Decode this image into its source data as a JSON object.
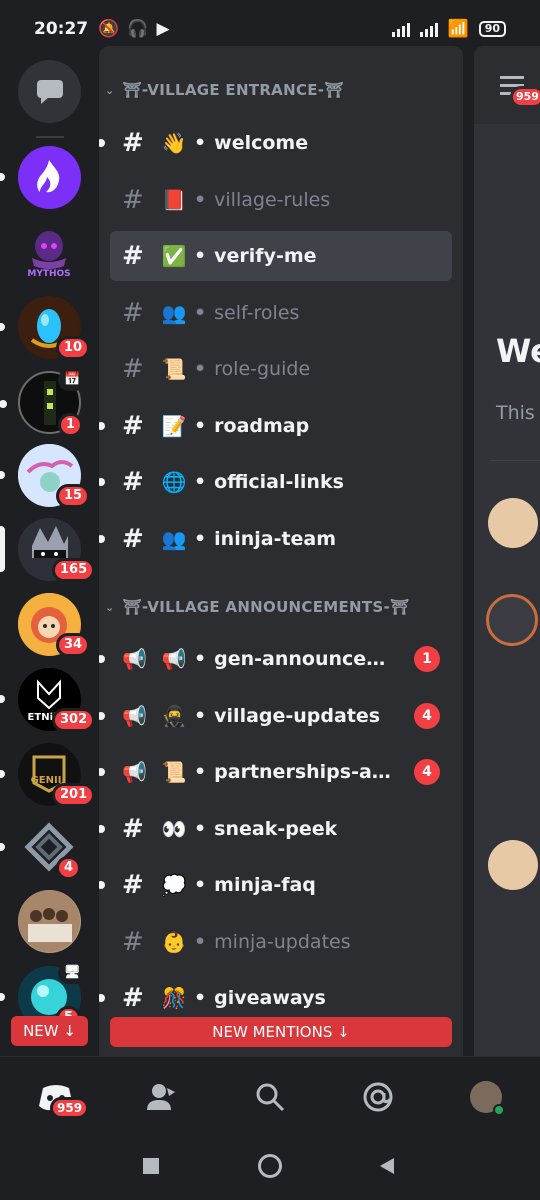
{
  "status_bar": {
    "time": "20:27",
    "battery": "90"
  },
  "servers": [
    {
      "name": "server-1-flame",
      "badge": ""
    },
    {
      "name": "server-2-mythos",
      "label": "MYTHOS",
      "badge": ""
    },
    {
      "name": "server-3-egg",
      "badge": "10"
    },
    {
      "name": "server-4",
      "badge": "1"
    },
    {
      "name": "server-5",
      "badge": "15"
    },
    {
      "name": "server-6",
      "badge": "165"
    },
    {
      "name": "server-7",
      "badge": "34"
    },
    {
      "name": "server-8",
      "label": "ETNii",
      "badge": "302"
    },
    {
      "name": "server-9",
      "label": "GENII",
      "badge": "201"
    },
    {
      "name": "server-10",
      "badge": "4"
    },
    {
      "name": "server-11",
      "badge": ""
    },
    {
      "name": "server-12",
      "badge": "5"
    }
  ],
  "categories": [
    {
      "label": "⛩-VILLAGE ENTRANCE-⛩"
    },
    {
      "label": "⛩-VILLAGE ANNOUNCEMENTS-⛩"
    }
  ],
  "channels": [
    {
      "emoji": "👋",
      "name": "welcome",
      "badge": ""
    },
    {
      "emoji": "📕",
      "name": "village-rules",
      "badge": ""
    },
    {
      "emoji": "✅",
      "name": "verify-me",
      "badge": ""
    },
    {
      "emoji": "👥",
      "name": "self-roles",
      "badge": ""
    },
    {
      "emoji": "📜",
      "name": "role-guide",
      "badge": ""
    },
    {
      "emoji": "📝",
      "name": "roadmap",
      "badge": ""
    },
    {
      "emoji": "🌐",
      "name": "official-links",
      "badge": ""
    },
    {
      "emoji": "👥",
      "name": "ininja-team",
      "badge": ""
    },
    {
      "emoji": "📢",
      "name": "gen-announceme...",
      "badge": "1"
    },
    {
      "emoji": "🥷",
      "name": "village-updates",
      "badge": "4"
    },
    {
      "emoji": "📜",
      "name": "partnerships-ann...",
      "badge": "4"
    },
    {
      "emoji": "👀",
      "name": "sneak-peek",
      "badge": ""
    },
    {
      "emoji": "💭",
      "name": "minja-faq",
      "badge": ""
    },
    {
      "emoji": "👶",
      "name": "minja-updates",
      "badge": ""
    },
    {
      "emoji": "🎊",
      "name": "giveaways",
      "badge": ""
    }
  ],
  "new_mentions_label": "NEW MENTIONS ↓",
  "new_label": "NEW ↓",
  "peek": {
    "title": "We",
    "subtitle": "This",
    "notif_count": "959"
  },
  "bottom_nav": {
    "home_badge": "959"
  },
  "colors": {
    "accent": "#5865f2",
    "badge_red": "#f23f43",
    "panel": "#2b2d31",
    "rail": "#1e1f22"
  }
}
